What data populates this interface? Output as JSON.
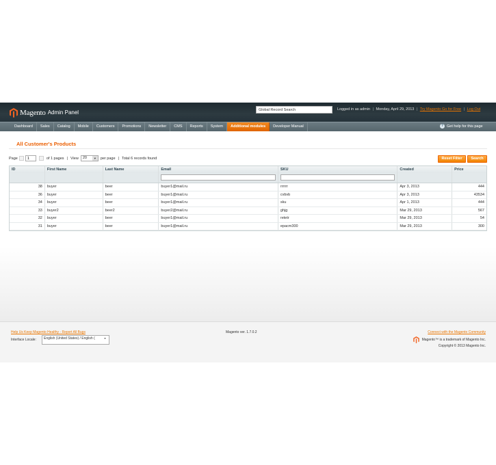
{
  "header": {
    "logo_brand": "Magento",
    "logo_panel": "Admin Panel",
    "search_value": "Global Record Search",
    "logged_in": "Logged in as admin",
    "date": "Monday, April 29, 2013",
    "try_link": "Try Magento Go for Free",
    "logout": "Log Out"
  },
  "nav": {
    "items": [
      "Dashboard",
      "Sales",
      "Catalog",
      "Mobile",
      "Customers",
      "Promotions",
      "Newsletter",
      "CMS",
      "Reports",
      "System",
      "Additional modules",
      "Developer Manual"
    ],
    "active": "Additional modules",
    "help": "Get help for this page",
    "help_icon": "question-icon"
  },
  "page": {
    "title": "All Customer's Products"
  },
  "pager": {
    "page_label": "Page",
    "page_value": "1",
    "of_pages": "of 1 pages",
    "view_label": "View",
    "per_page_value": "20",
    "per_page_label": "per page",
    "total": "Total 6 records found"
  },
  "buttons": {
    "reset": "Reset Filter",
    "search": "Search"
  },
  "grid": {
    "columns": [
      "ID",
      "First Name",
      "Last Name",
      "Email",
      "SKU",
      "Created",
      "Price"
    ],
    "rows": [
      {
        "id": "38",
        "first": "buyer",
        "last": "beer",
        "email": "buyer1@mail.ru",
        "sku": "rrrrrr",
        "created": "Apr 3, 2013",
        "price": "444"
      },
      {
        "id": "36",
        "first": "buyer",
        "last": "beer",
        "email": "buyer1@mail.ru",
        "sku": "cvbvb",
        "created": "Apr 3, 2013",
        "price": "43534"
      },
      {
        "id": "34",
        "first": "buyer",
        "last": "beer",
        "email": "buyer1@mail.ru",
        "sku": "sku",
        "created": "Apr 1, 2013",
        "price": "444"
      },
      {
        "id": "33",
        "first": "buyer2",
        "last": "beer2",
        "email": "buyer2@mail.ru",
        "sku": "ghjg",
        "created": "Mar 29, 2013",
        "price": "567"
      },
      {
        "id": "32",
        "first": "buyer",
        "last": "beer",
        "email": "buyer1@mail.ru",
        "sku": "retetr",
        "created": "Mar 29, 2013",
        "price": "54"
      },
      {
        "id": "31",
        "first": "buyer",
        "last": "beer",
        "email": "buyer1@mail.ru",
        "sku": "epacm300",
        "created": "Mar 29, 2013",
        "price": "300"
      }
    ]
  },
  "footer": {
    "help_link": "Help Us Keep Magento Healthy - Report All Bugs",
    "locale_label": "Interface Locale:",
    "locale_value": "English (United States) / English (",
    "version": "Magento ver. 1.7.0.2",
    "community_link": "Connect with the Magento Community",
    "trademark": "Magento™ is a trademark of Magento Inc.",
    "copyright": "Copyright © 2013 Magento Inc."
  },
  "colors": {
    "accent": "#eb5e00",
    "header_bg": "#27343a",
    "nav_bg": "#5f6f76"
  }
}
